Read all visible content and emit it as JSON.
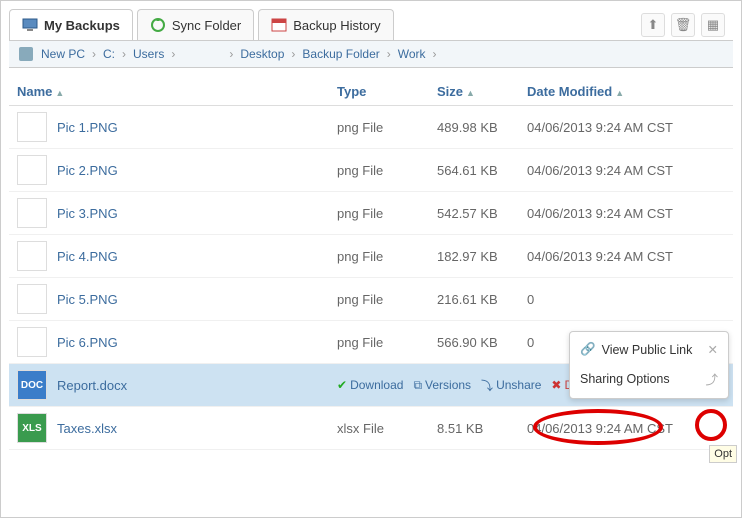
{
  "tabs": [
    {
      "label": "My Backups",
      "active": true
    },
    {
      "label": "Sync Folder",
      "active": false
    },
    {
      "label": "Backup History",
      "active": false
    }
  ],
  "breadcrumb": [
    "New PC",
    "C:",
    "Users",
    "",
    "Desktop",
    "Backup Folder",
    "Work"
  ],
  "columns": {
    "name": "Name",
    "type": "Type",
    "size": "Size",
    "date": "Date Modified"
  },
  "files": [
    {
      "name": "Pic 1.PNG",
      "type": "png File",
      "size": "489.98 KB",
      "date": "04/06/2013 9:24 AM CST"
    },
    {
      "name": "Pic 2.PNG",
      "type": "png File",
      "size": "564.61 KB",
      "date": "04/06/2013 9:24 AM CST"
    },
    {
      "name": "Pic 3.PNG",
      "type": "png File",
      "size": "542.57 KB",
      "date": "04/06/2013 9:24 AM CST"
    },
    {
      "name": "Pic 4.PNG",
      "type": "png File",
      "size": "182.97 KB",
      "date": "04/06/2013 9:24 AM CST"
    },
    {
      "name": "Pic 5.PNG",
      "type": "png File",
      "size": "216.61 KB",
      "date": "0"
    },
    {
      "name": "Pic 6.PNG",
      "type": "png File",
      "size": "566.90 KB",
      "date": "0"
    },
    {
      "name": "Report.docx",
      "type": "",
      "size": "",
      "date": "",
      "selected": true,
      "actions": {
        "download": "Download",
        "versions": "Versions",
        "unshare": "Unshare",
        "delete": "Delete"
      }
    },
    {
      "name": "Taxes.xlsx",
      "type": "xlsx File",
      "size": "8.51 KB",
      "date": "04/06/2013 9:24 AM CST"
    }
  ],
  "popup": {
    "view_link": "View Public Link",
    "sharing": "Sharing Options"
  },
  "tooltip": "Opt"
}
